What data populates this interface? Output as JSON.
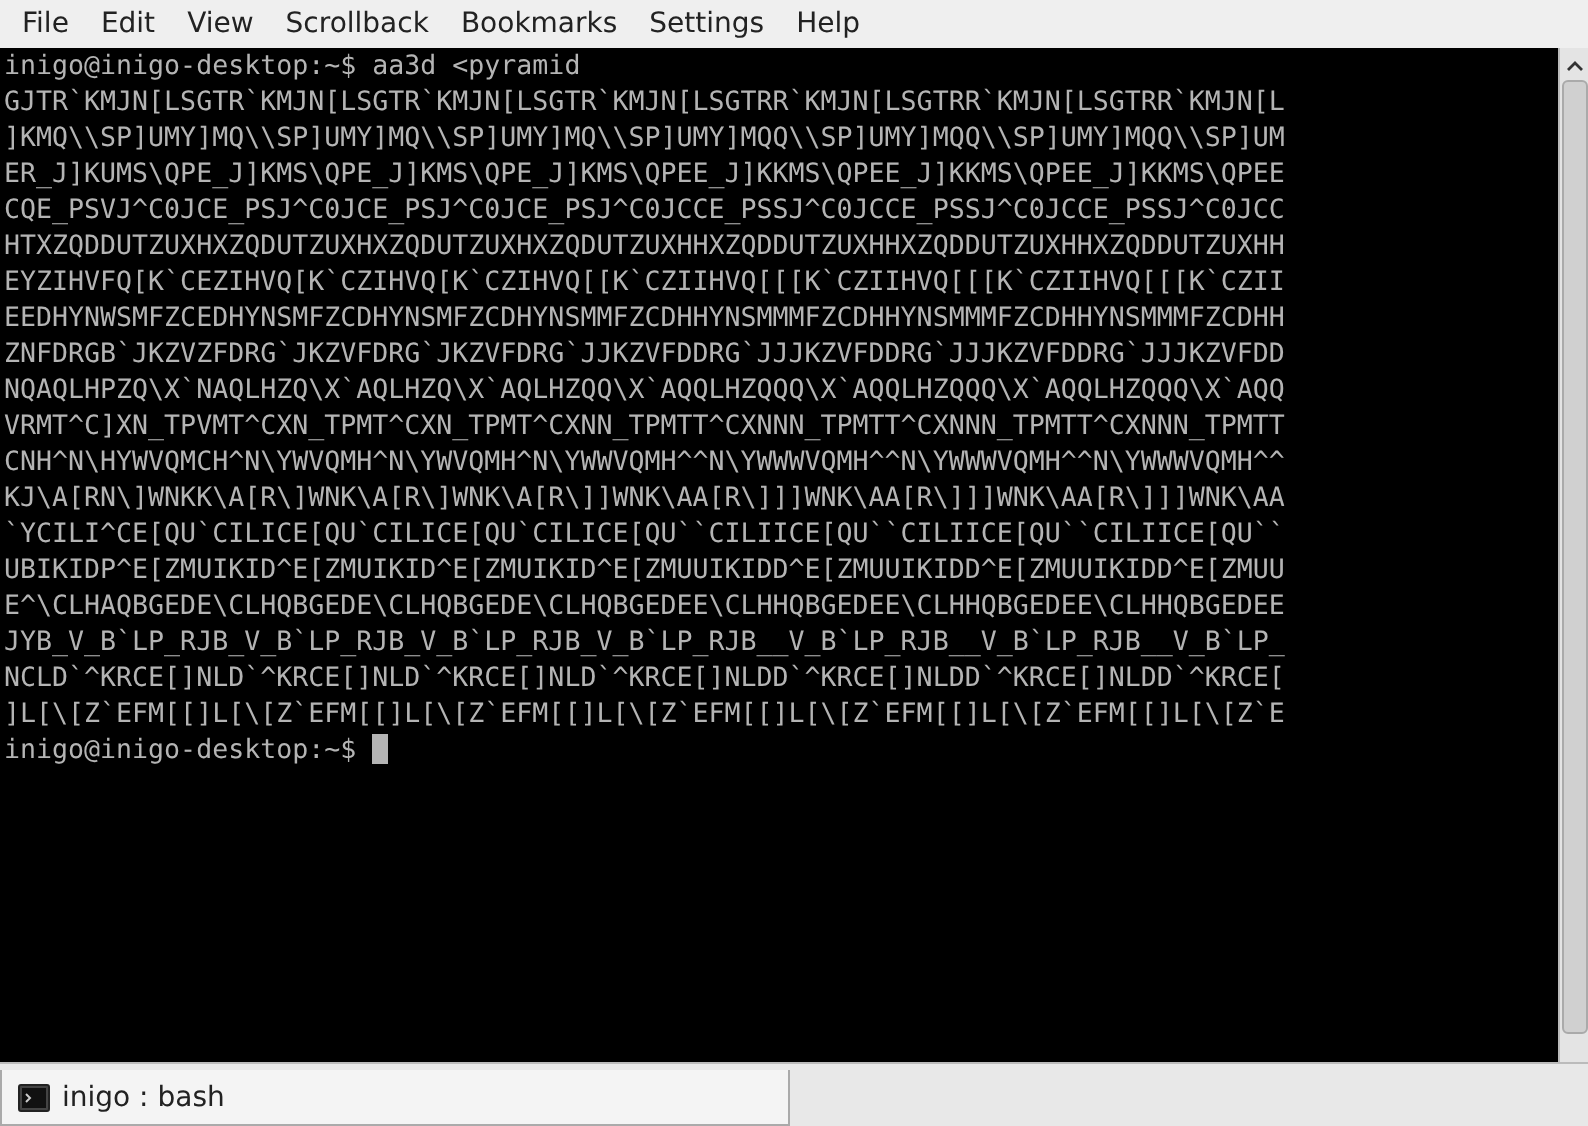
{
  "menu": [
    "File",
    "Edit",
    "View",
    "Scrollback",
    "Bookmarks",
    "Settings",
    "Help"
  ],
  "terminal": {
    "lines": [
      "inigo@inigo-desktop:~$ aa3d <pyramid",
      "GJTR`KMJN[LSGTR`KMJN[LSGTR`KMJN[LSGTR`KMJN[LSGTRR`KMJN[LSGTRR`KMJN[LSGTRR`KMJN[L",
      "]KMQ\\\\SP]UMY]MQ\\\\SP]UMY]MQ\\\\SP]UMY]MQ\\\\SP]UMY]MQQ\\\\SP]UMY]MQQ\\\\SP]UMY]MQQ\\\\SP]UM",
      "ER_J]KUMS\\QPE_J]KMS\\QPE_J]KMS\\QPE_J]KMS\\QPEE_J]KKMS\\QPEE_J]KKMS\\QPEE_J]KKMS\\QPEE",
      "CQE_PSVJ^C0JCE_PSJ^C0JCE_PSJ^C0JCE_PSJ^C0JCCE_PSSJ^C0JCCE_PSSJ^C0JCCE_PSSJ^C0JCC",
      "HTXZQDDUTZUXHXZQDUTZUXHXZQDUTZUXHXZQDUTZUXHHXZQDDUTZUXHHXZQDDUTZUXHHXZQDDUTZUXHH",
      "EYZIHVFQ[K`CEZIHVQ[K`CZIHVQ[K`CZIHVQ[[K`CZIIHVQ[[[K`CZIIHVQ[[[K`CZIIHVQ[[[K`CZII",
      "EEDHYNWSMFZCEDHYNSMFZCDHYNSMFZCDHYNSMMFZCDHHYNSMMMFZCDHHYNSMMMFZCDHHYNSMMMFZCDHH",
      "ZNFDRGB`JKZVZFDRG`JKZVFDRG`JKZVFDRG`JJKZVFDDRG`JJJKZVFDDRG`JJJKZVFDDRG`JJJKZVFDD",
      "NQAQLHPZQ\\X`NAQLHZQ\\X`AQLHZQ\\X`AQLHZQQ\\X`AQQLHZQQQ\\X`AQQLHZQQQ\\X`AQQLHZQQQ\\X`AQQ",
      "VRMT^C]XN_TPVMT^CXN_TPMT^CXN_TPMT^CXNN_TPMTT^CXNNN_TPMTT^CXNNN_TPMTT^CXNNN_TPMTT",
      "CNH^N\\HYWVQMCH^N\\YWVQMH^N\\YWVQMH^N\\YWWVQMH^^N\\YWWWVQMH^^N\\YWWWVQMH^^N\\YWWWVQMH^^",
      "KJ\\A[RN\\]WNKK\\A[R\\]WNK\\A[R\\]WNK\\A[R\\]]WNK\\AA[R\\]]]WNK\\AA[R\\]]]WNK\\AA[R\\]]]WNK\\AA",
      "`YCILI^CE[QU`CILICE[QU`CILICE[QU`CILICE[QU``CILIICE[QU``CILIICE[QU``CILIICE[QU``",
      "UBIKIDP^E[ZMUIKID^E[ZMUIKID^E[ZMUIKID^E[ZMUUIKIDD^E[ZMUUIKIDD^E[ZMUUIKIDD^E[ZMUU",
      "E^\\CLHAQBGEDE\\CLHQBGEDE\\CLHQBGEDE\\CLHQBGEDEE\\CLHHQBGEDEE\\CLHHQBGEDEE\\CLHHQBGEDEE",
      "JYB_V_B`LP_RJB_V_B`LP_RJB_V_B`LP_RJB_V_B`LP_RJB__V_B`LP_RJB__V_B`LP_RJB__V_B`LP_",
      "NCLD`^KRCE[]NLD`^KRCE[]NLD`^KRCE[]NLD`^KRCE[]NLDD`^KRCE[]NLDD`^KRCE[]NLDD`^KRCE[",
      "]L[\\[Z`EFM[[]L[\\[Z`EFM[[]L[\\[Z`EFM[[]L[\\[Z`EFM[[]L[\\[Z`EFM[[]L[\\[Z`EFM[[]L[\\[Z`E",
      "inigo@inigo-desktop:~$ "
    ],
    "cursor": true
  },
  "tabs": [
    {
      "label": "inigo : bash",
      "selected": true
    }
  ]
}
